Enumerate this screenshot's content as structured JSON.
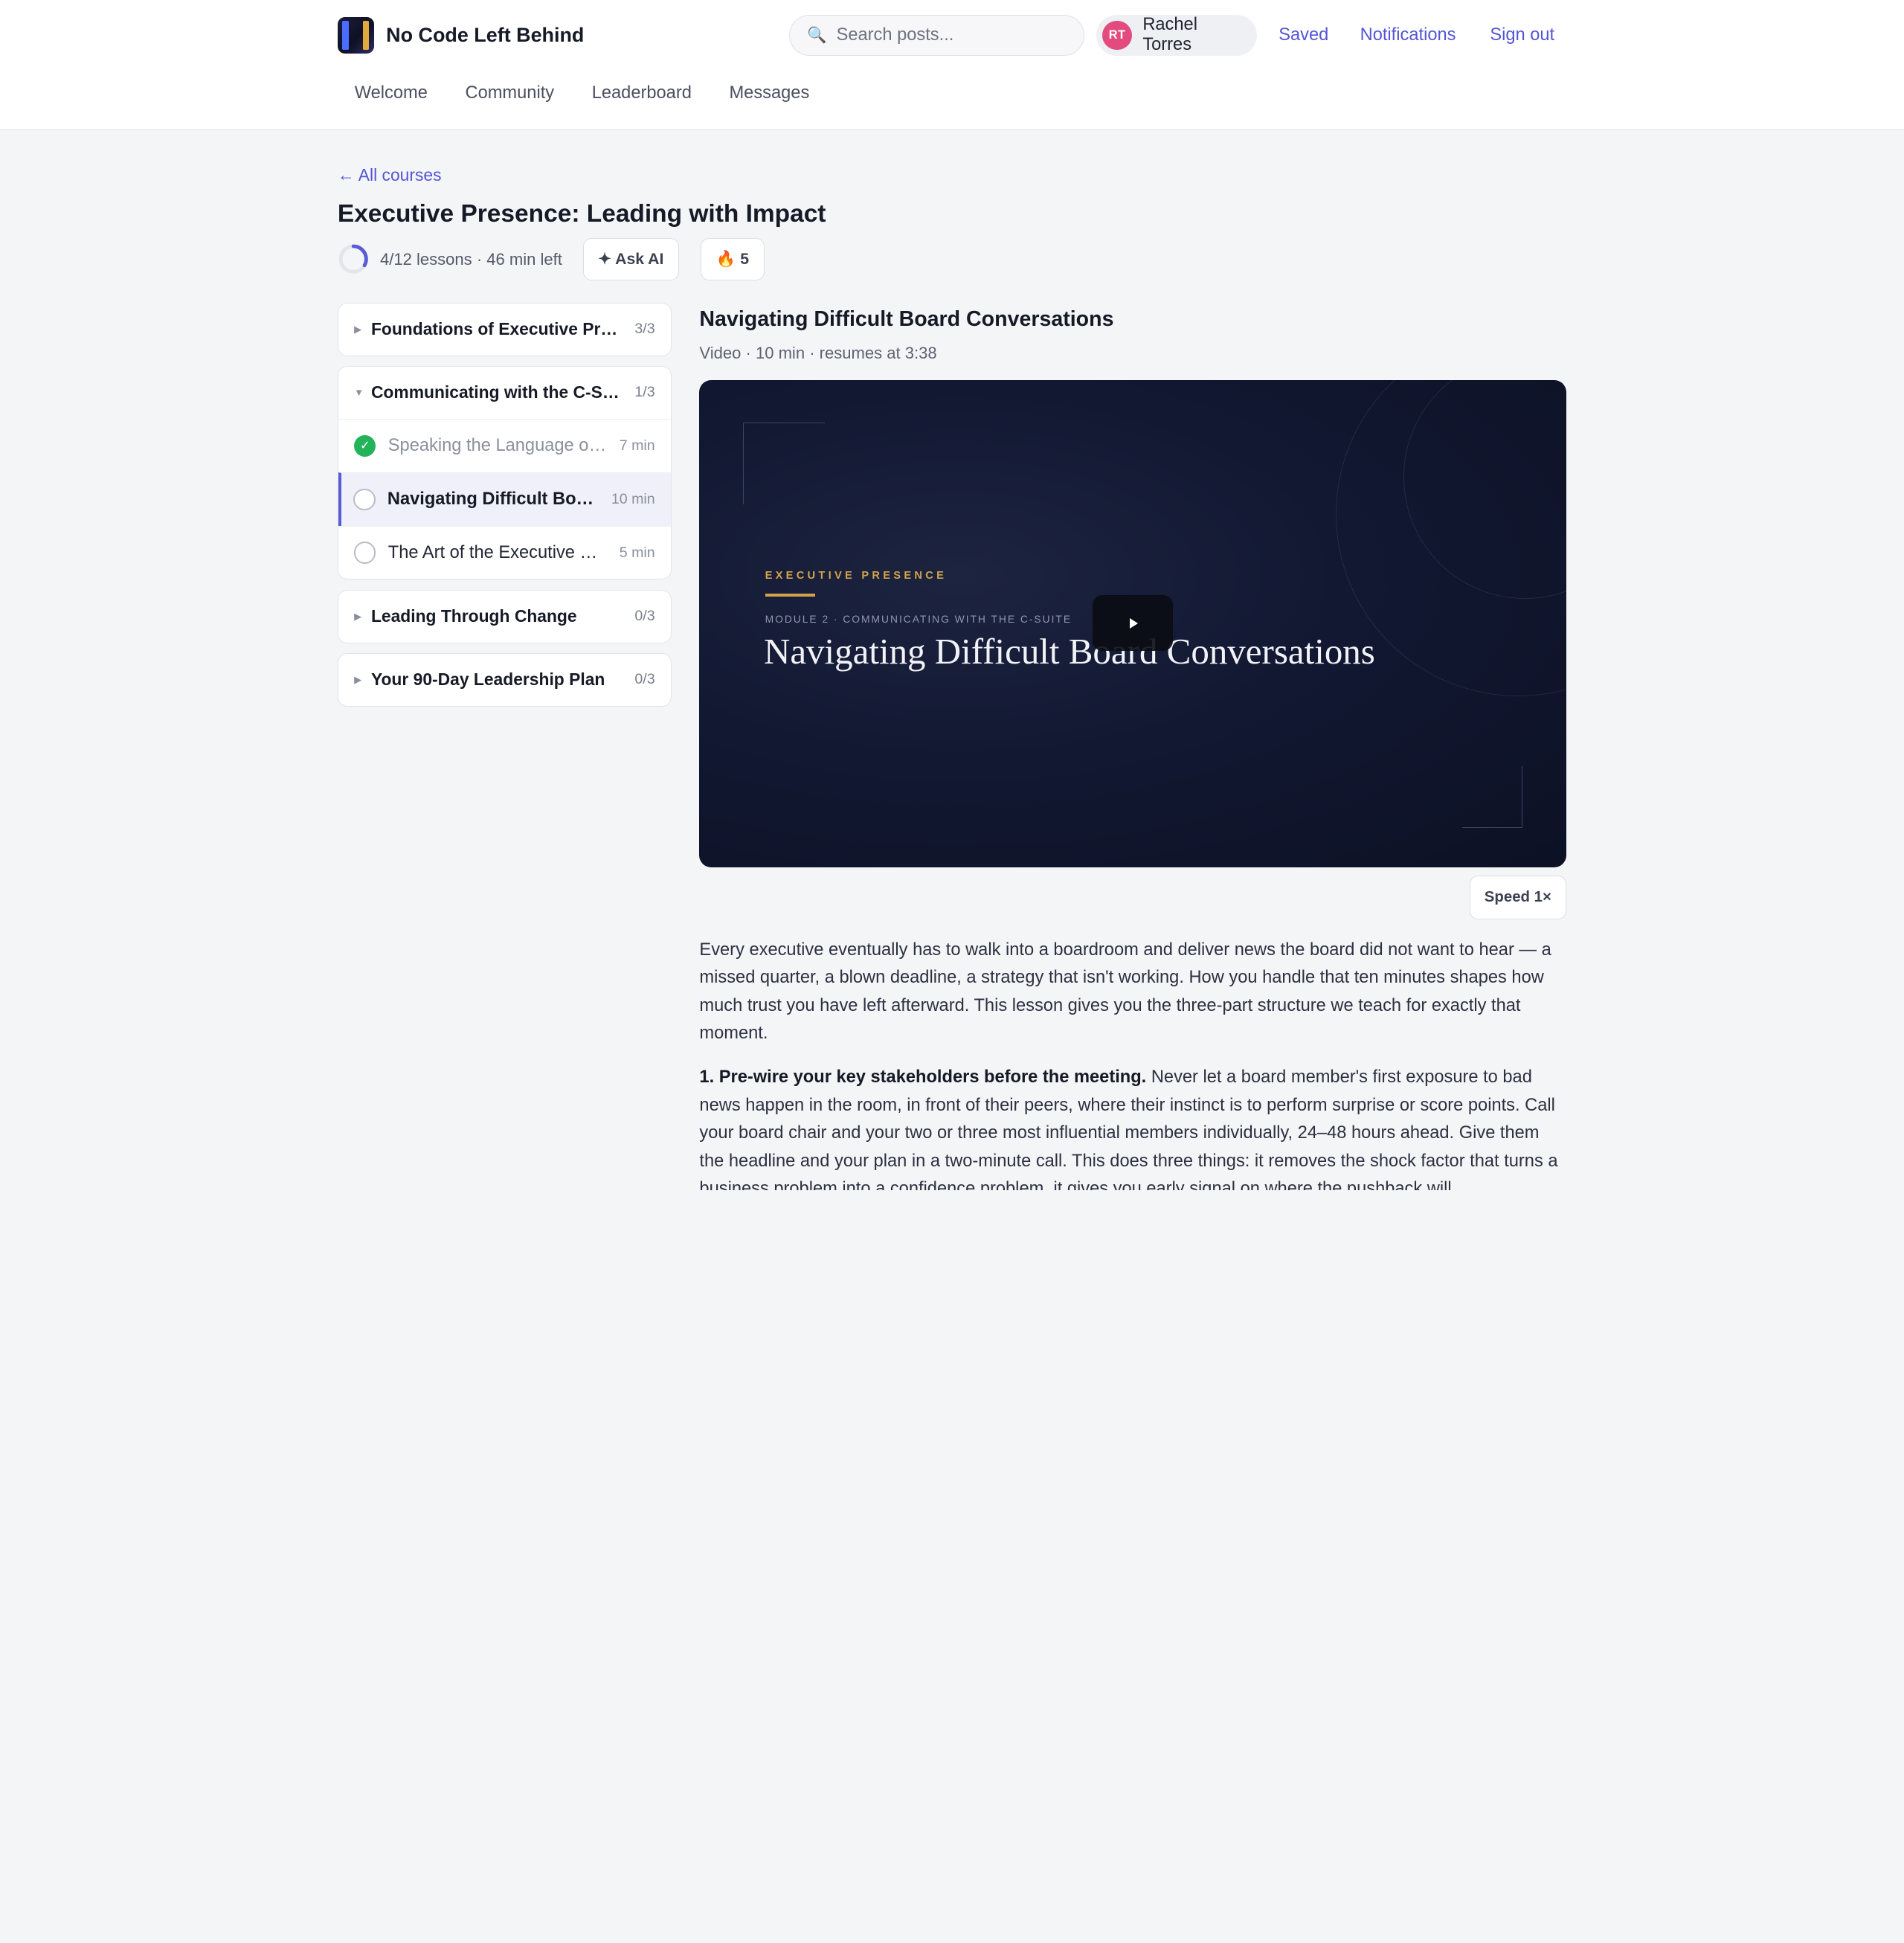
{
  "brand": {
    "name": "No Code Left Behind"
  },
  "search": {
    "placeholder": "Search posts...",
    "value": ""
  },
  "user": {
    "initials": "RT",
    "name": "Rachel Torres",
    "avatar_color": "#e34b7f"
  },
  "header_links": {
    "saved": "Saved",
    "notifications": "Notifications",
    "sign_out": "Sign out"
  },
  "nav_tabs": [
    "Welcome",
    "Community",
    "Leaderboard",
    "Messages"
  ],
  "course": {
    "back_label": "← All courses",
    "title": "Executive Presence: Leading with Impact",
    "progress_text": "4/12 lessons · 46 min left",
    "progress_fraction": 0.333,
    "ask_ai_label": "✦ Ask AI",
    "streak_label": "🔥 5"
  },
  "modules": [
    {
      "title": "Foundations of Executive Presence",
      "count": "3/3",
      "expanded": false
    },
    {
      "title": "Communicating with the C-Suite",
      "count": "1/3",
      "expanded": true,
      "lessons": [
        {
          "title": "Speaking the Language of the Board",
          "duration": "7 min",
          "status": "done"
        },
        {
          "title": "Navigating Difficult Board Conversations",
          "duration": "10 min",
          "status": "active"
        },
        {
          "title": "The Art of the Executive Summary",
          "duration": "5 min",
          "status": "todo"
        }
      ]
    },
    {
      "title": "Leading Through Change",
      "count": "0/3",
      "expanded": false
    },
    {
      "title": "Your 90-Day Leadership Plan",
      "count": "0/3",
      "expanded": false
    }
  ],
  "lesson": {
    "title": "Navigating Difficult Board Conversations",
    "meta": "Video · 10 min · resumes at 3:38",
    "video": {
      "eyebrow": "EXECUTIVE PRESENCE",
      "module_label": "MODULE 2 · COMMUNICATING WITH THE C-SUITE",
      "title": "Navigating Difficult Board Conversations"
    },
    "speed_label": "Speed 1×",
    "paragraphs": [
      "Every executive eventually has to walk into a boardroom and deliver news the board did not want to hear — a missed quarter, a blown deadline, a strategy that isn't working. How you handle that ten minutes shapes how much trust you have left afterward. This lesson gives you the three-part structure we teach for exactly that moment."
    ],
    "point1_heading": "1. Pre-wire your key stakeholders before the meeting.",
    "point1_body": " Never let a board member's first exposure to bad news happen in the room, in front of their peers, where their instinct is to perform surprise or score points. Call your board chair and your two or three most influential members individually, 24–48 hours ahead. Give them the headline and your plan in a two-minute call. This does three things: it removes the shock factor that turns a business problem into a confidence problem, it gives you early signal on where the pushback will"
  },
  "colors": {
    "accent": "#5b5bd6",
    "done": "#22b35b",
    "video_bg": "#121832",
    "gold": "#d2a44a"
  }
}
